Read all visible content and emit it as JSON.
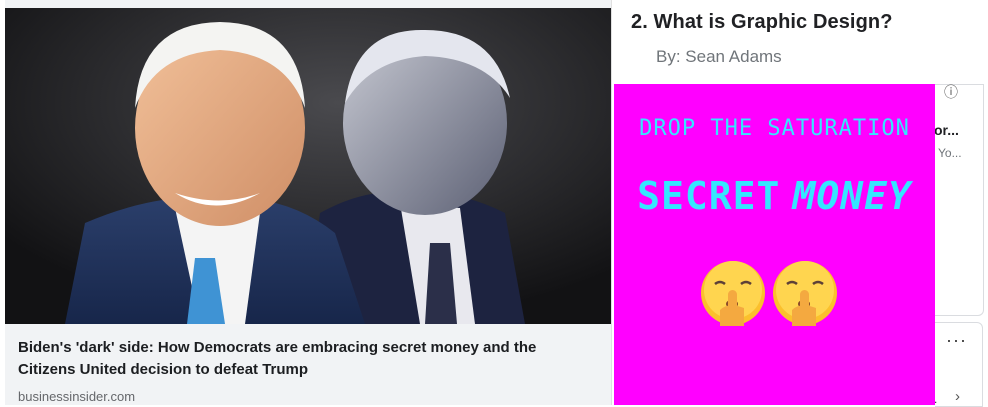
{
  "link_card": {
    "headline": "Biden's 'dark' side: How Democrats are embracing secret money and the Citizens United decision to defeat Trump",
    "domain": "businessinsider.com"
  },
  "suggestion": {
    "title": "2. What is Graphic Design?",
    "byline": "By: Sean Adams",
    "peek_title": "or...",
    "peek_subtitle": "Yo...",
    "peek_trailing": "."
  },
  "meme": {
    "top_text": "DROP THE SATURATION",
    "big_word_1": "SECRET",
    "big_word_2": "MONEY",
    "background": "#ff00ff",
    "text_color": "#35e6ff",
    "emoji": [
      "shushing-face",
      "shushing-face"
    ]
  },
  "icons": {
    "info": "ⓘ",
    "more": "···",
    "chevron": "›"
  }
}
